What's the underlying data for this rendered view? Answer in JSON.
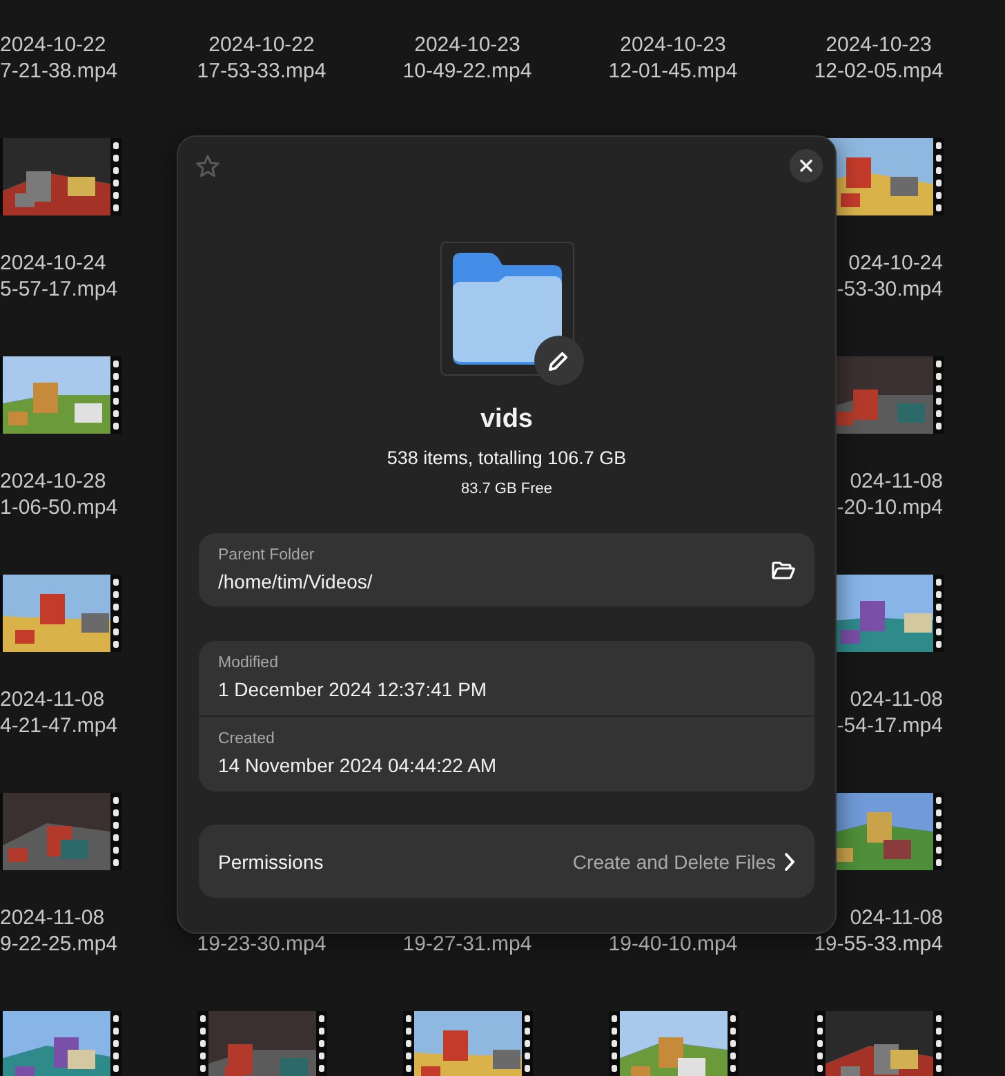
{
  "grid": {
    "top_row": [
      {
        "lines": [
          "2024-10-22",
          "7-21-38.mp4"
        ]
      },
      {
        "lines": [
          "2024-10-22",
          "17-53-33.mp4"
        ]
      },
      {
        "lines": [
          "2024-10-23",
          "10-49-22.mp4"
        ]
      },
      {
        "lines": [
          "2024-10-23",
          "12-01-45.mp4"
        ]
      },
      {
        "lines": [
          "2024-10-23",
          "12-02-05.mp4"
        ]
      }
    ],
    "left_column": [
      {
        "thumbnail": {
          "kind": "picture"
        },
        "lines": [
          "2024-10-24",
          "5-57-17.mp4"
        ]
      },
      {
        "thumbnail": {
          "kind": "picture"
        },
        "lines": [
          "2024-10-28",
          "1-06-50.mp4"
        ]
      },
      {
        "thumbnail": {
          "kind": "picture"
        },
        "lines": [
          "2024-11-08",
          "4-21-47.mp4"
        ]
      },
      {
        "thumbnail": {
          "kind": "picture"
        },
        "lines": [
          "2024-11-08",
          "9-22-25.mp4"
        ]
      }
    ],
    "right_column": [
      {
        "thumbnail": {
          "kind": "picture"
        },
        "lines": [
          "024-10-24",
          "-53-30.mp4"
        ]
      },
      {
        "thumbnail": {
          "kind": "picture"
        },
        "lines": [
          "024-11-08",
          "-20-10.mp4"
        ]
      },
      {
        "thumbnail": {
          "kind": "picture"
        },
        "lines": [
          "024-11-08",
          "-54-17.mp4"
        ]
      },
      {
        "thumbnail": {
          "kind": "picture"
        },
        "lines": [
          "024-11-08",
          "19-55-33.mp4"
        ]
      }
    ],
    "below_dialog": [
      {
        "lines": [
          "19-23-30.mp4"
        ]
      },
      {
        "lines": [
          "19-27-31.mp4"
        ]
      },
      {
        "lines": [
          "19-40-10.mp4"
        ]
      }
    ],
    "bottom_row": [
      {
        "thumbnail": {
          "kind": "picture"
        }
      },
      {
        "thumbnail": {
          "kind": "picture"
        }
      },
      {
        "thumbnail": {
          "kind": "picture"
        }
      },
      {
        "thumbnail": {
          "kind": "picture"
        }
      },
      {
        "thumbnail": {
          "kind": "picture"
        }
      }
    ]
  },
  "dialog": {
    "starred": false,
    "name": "vids",
    "summary": "538 items, totalling 106.7 GB",
    "free": "83.7 GB Free",
    "parent": {
      "label": "Parent Folder",
      "value": "/home/tim/Videos/"
    },
    "dates": [
      {
        "label": "Modified",
        "value": "1 December 2024 12:37:41 PM"
      },
      {
        "label": "Created",
        "value": "14 November 2024 04:44:22 AM"
      }
    ],
    "permissions": {
      "label": "Permissions",
      "value": "Create and Delete Files"
    }
  }
}
